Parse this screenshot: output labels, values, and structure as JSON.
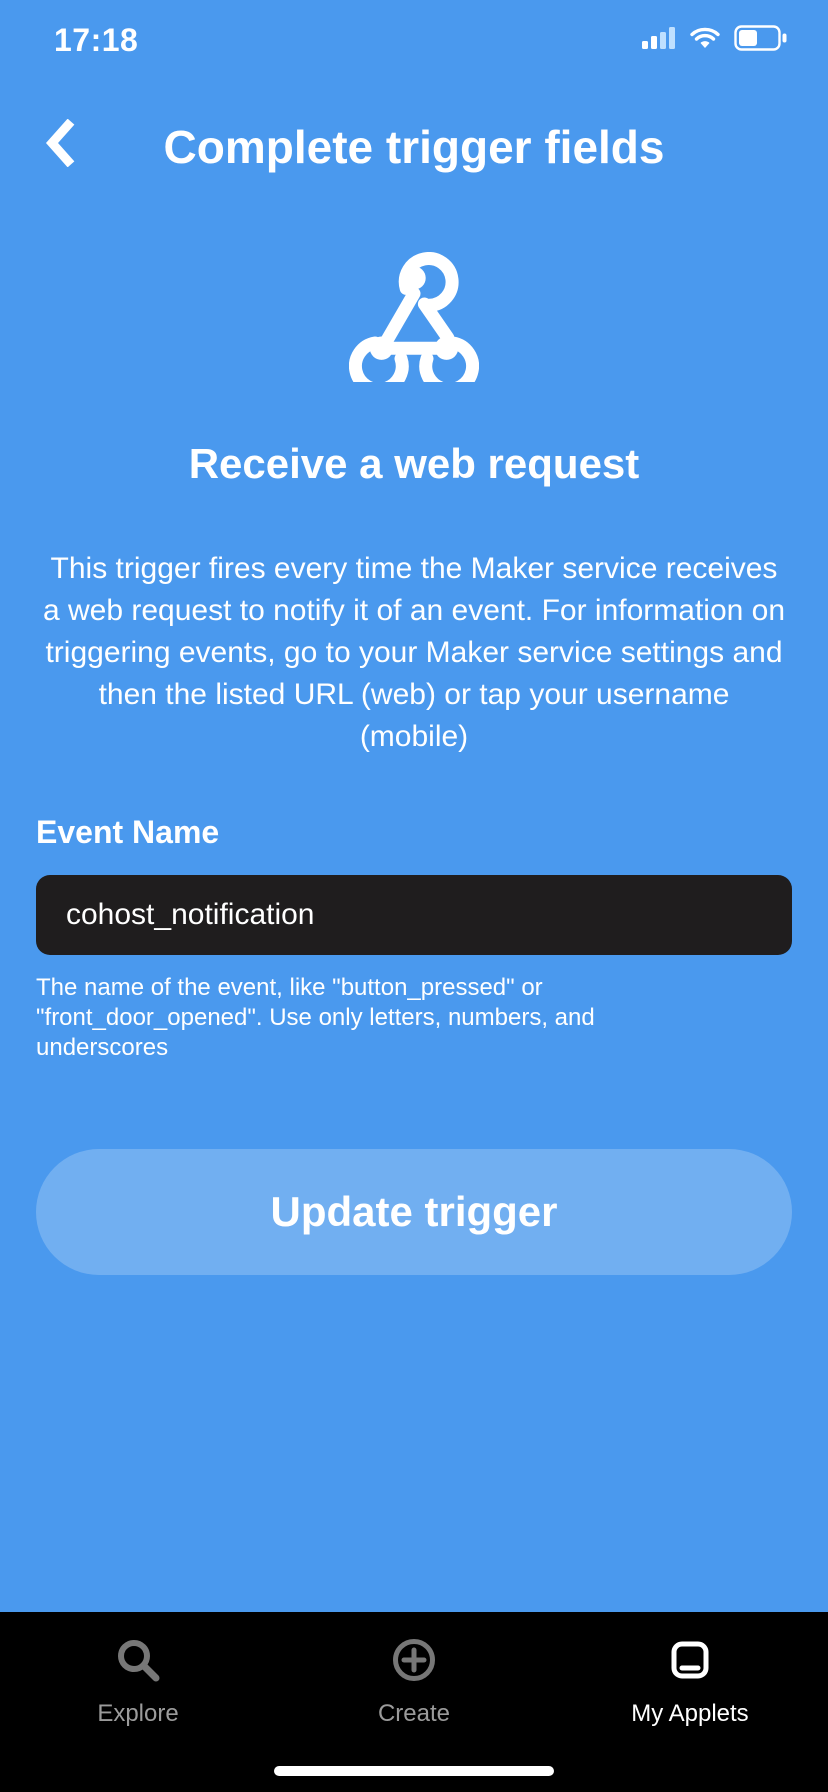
{
  "status": {
    "time": "17:18"
  },
  "header": {
    "title": "Complete trigger fields"
  },
  "trigger": {
    "title": "Receive a web request",
    "description": "This trigger fires every time the Maker service receives a web request to notify it of an event. For information on triggering events, go to your Maker service settings and then the listed URL (web) or tap your username (mobile)"
  },
  "field": {
    "label": "Event Name",
    "value": "cohost_notification",
    "help": "The name of the event, like \"button_pressed\" or \"front_door_opened\". Use only letters, numbers, and underscores"
  },
  "action": {
    "primary": "Update trigger"
  },
  "tabs": {
    "explore": "Explore",
    "create": "Create",
    "my_applets": "My Applets"
  }
}
